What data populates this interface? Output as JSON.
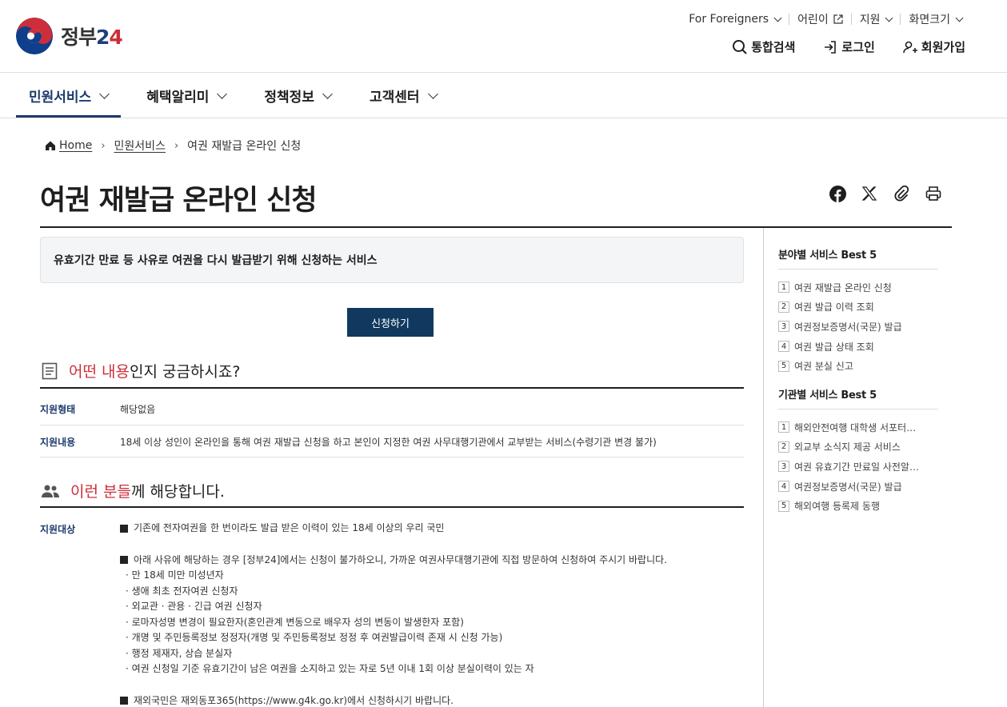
{
  "header": {
    "logo_text": "정부",
    "logo_num": "2",
    "logo_four": "4",
    "util": [
      {
        "label": "For Foreigners"
      },
      {
        "label": "어린이"
      },
      {
        "label": "지원"
      },
      {
        "label": "화면크기"
      }
    ],
    "search_label": "통합검색",
    "login_label": "로그인",
    "signup_label": "회원가입"
  },
  "gnb": [
    {
      "label": "민원서비스",
      "active": true
    },
    {
      "label": "혜택알리미"
    },
    {
      "label": "정책정보"
    },
    {
      "label": "고객센터"
    }
  ],
  "breadcrumb": {
    "home": "Home",
    "level1": "민원서비스",
    "current": "여권 재발급 온라인 신청"
  },
  "page_title": "여권 재발급 온라인 신청",
  "summary": "유효기간 만료 등 사유로 여권을 다시 발급받기 위해 신청하는 서비스",
  "apply_button": "신청하기",
  "section1": {
    "title_red": "어떤 내용",
    "title_rest": "인지 궁금하시죠?",
    "rows": [
      {
        "label": "지원형태",
        "value": "해당없음"
      },
      {
        "label": "지원내용",
        "value": "18세 이상 성인이 온라인을 통해 여권 재발급 신청을 하고 본인이 지정한 여권 사무대행기관에서 교부받는 서비스(수령기관 변경 불가)"
      }
    ]
  },
  "section2": {
    "title_red": "이런 분들",
    "title_rest": "께 해당합니다.",
    "label": "지원대상",
    "bullet1": "기존에 전자여권을 한 번이라도 발급 받은 이력이 있는 18세 이상의 우리 국민",
    "bullet2": "아래 사유에 해당하는 경우 [정부24]에서는 신청이 불가하오니, 가까운 여권사무대행기관에 직접 방문하여 신청하여 주시기 바랍니다.",
    "subs": [
      "·  만 18세 미만 미성년자",
      "·  생애 최초 전자여권 신청자",
      "·  외교관 · 관용 · 긴급 여권 신청자",
      "·  로마자성명 변경이 필요한자(혼인관계 변동으로 배우자 성의 변동이 발생한자 포함)",
      "·  개명 및 주민등록정보 정정자(개명 및 주민등록정보 정정 후 여권발급이력 존재 시 신청 가능)",
      "·  행정 제재자, 상습 분실자",
      "·  여권 신청일 기준 유효기간이 남은 여권을 소지하고 있는 자로 5년 이내 1회 이상 분실이력이 있는 자"
    ],
    "bullet3": "재외국민은 재외동포365(https://www.g4k.go.kr)에서 신청하시기 바랍니다."
  },
  "side": {
    "best_field_title": "분야별 서비스 Best 5",
    "best_field": [
      "여권 재발급 온라인 신청",
      "여권 발급 이력 조회",
      "여권정보증명서(국문) 발급",
      "여권 발급 상태 조회",
      "여권 분실 신고"
    ],
    "best_org_title": "기관별 서비스 Best 5",
    "best_org": [
      "해외안전여행 대학생 서포터스 모집",
      "외교부 소식지 제공 서비스",
      "여권 유효기간 만료일 사전알림 서비스",
      "여권정보증명서(국문) 발급",
      "해외여행 등록제 동행"
    ]
  },
  "colors": {
    "navy": "#11395f",
    "accent_red": "#cd2e3a",
    "label_blue": "#1d3a6c"
  }
}
